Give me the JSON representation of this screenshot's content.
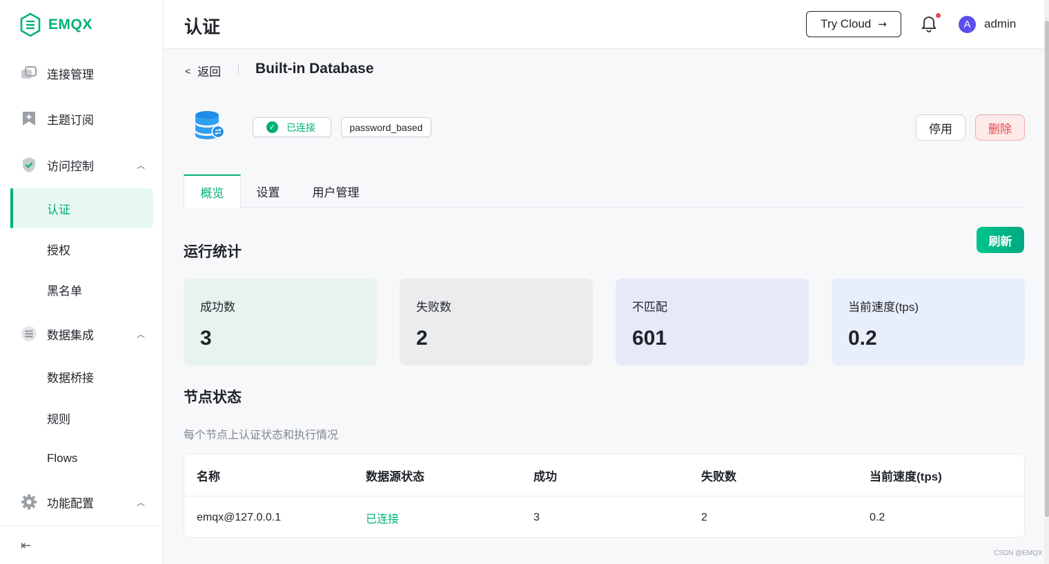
{
  "app": {
    "brand": "EMQX"
  },
  "sidebar": {
    "items": [
      {
        "label": "连接管理",
        "icon": "connections-icon"
      },
      {
        "label": "主题订阅",
        "icon": "bookmark-icon"
      },
      {
        "label": "访问控制",
        "icon": "shield-icon",
        "expanded": true
      },
      {
        "label": "数据集成",
        "icon": "database-stack-icon",
        "expanded": true
      },
      {
        "label": "功能配置",
        "icon": "gear-icon",
        "expanded": true
      }
    ],
    "access_sub": [
      "认证",
      "授权",
      "黑名单"
    ],
    "integration_sub": [
      "数据桥接",
      "规则",
      "Flows"
    ],
    "active": "认证"
  },
  "header": {
    "title": "认证",
    "try_cloud": "Try Cloud",
    "user_initial": "A",
    "username": "admin"
  },
  "page": {
    "back": "返回",
    "title": "Built-in Database",
    "status": "已连接",
    "mechanism": "password_based",
    "btn_disable": "停用",
    "btn_delete": "删除",
    "tabs": [
      "概览",
      "设置",
      "用户管理"
    ],
    "active_tab": "概览"
  },
  "stats": {
    "title": "运行统计",
    "refresh": "刷新",
    "cards": [
      {
        "label": "成功数",
        "value": "3",
        "color": "#e8f3f0"
      },
      {
        "label": "失败数",
        "value": "2",
        "color": "#ebecee"
      },
      {
        "label": "不匹配",
        "value": "601",
        "color": "#e7e9f8"
      },
      {
        "label": "当前速度(tps)",
        "value": "0.2",
        "color": "#e8eefa"
      }
    ]
  },
  "nodes": {
    "title": "节点状态",
    "desc": "每个节点上认证状态和执行情况",
    "columns": [
      "名称",
      "数据源状态",
      "成功",
      "失败数",
      "当前速度(tps)"
    ],
    "rows": [
      [
        "emqx@127.0.0.1",
        "已连接",
        "3",
        "2",
        "0.2"
      ]
    ]
  },
  "watermark": "CSDN @EMQX",
  "colors": {
    "accent": "#00b173",
    "danger": "#e5484d"
  }
}
